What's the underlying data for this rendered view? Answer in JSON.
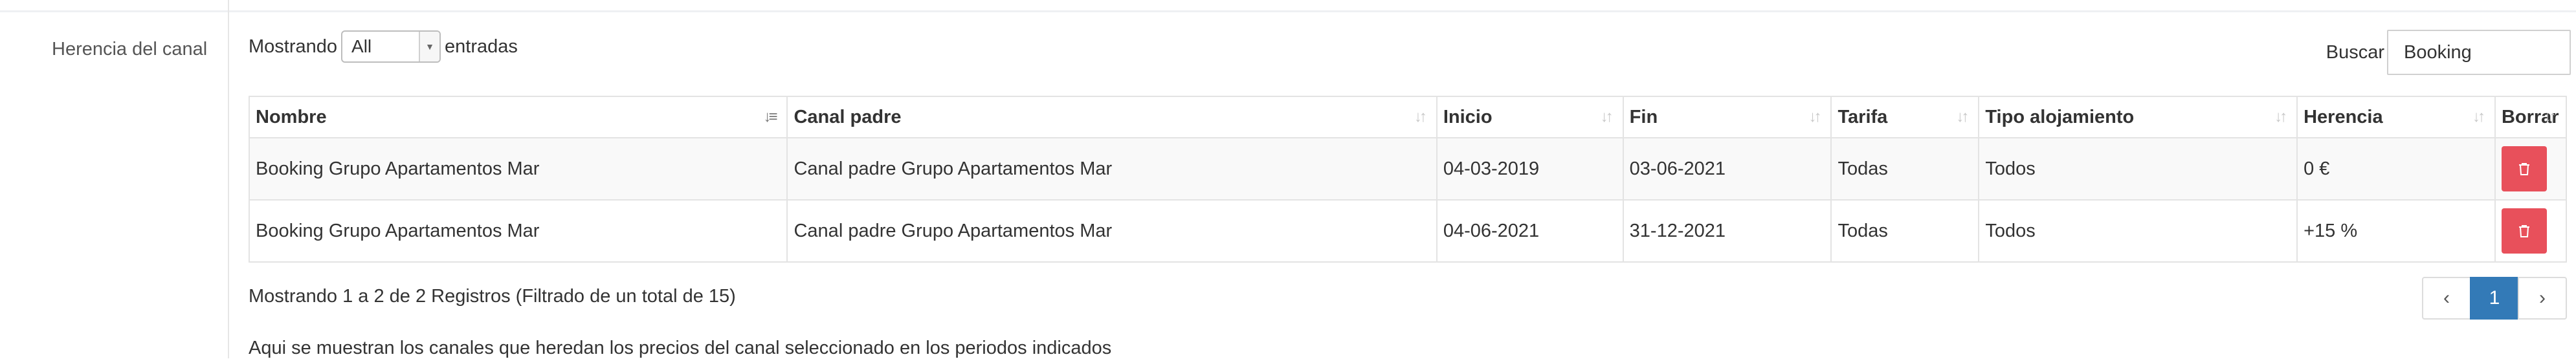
{
  "section": {
    "label": "Herencia del canal"
  },
  "length_control": {
    "prefix": "Mostrando",
    "selected": "All",
    "suffix": "entradas"
  },
  "search": {
    "label": "Buscar",
    "value": "Booking"
  },
  "table": {
    "headers": [
      "Nombre",
      "Canal padre",
      "Inicio",
      "Fin",
      "Tarifa",
      "Tipo alojamiento",
      "Herencia",
      "Borrar"
    ],
    "rows": [
      [
        "Booking Grupo Apartamentos Mar",
        "Canal padre Grupo Apartamentos Mar",
        "04-03-2019",
        "03-06-2021",
        "Todas",
        "Todos",
        "0 €"
      ],
      [
        "Booking Grupo Apartamentos Mar",
        "Canal padre Grupo Apartamentos Mar",
        "04-06-2021",
        "31-12-2021",
        "Todas",
        "Todos",
        "+15 %"
      ]
    ],
    "delete_icon": "trash-icon",
    "sort_icon": "sort-icon",
    "sorted_column": "Nombre"
  },
  "info": "Mostrando 1 a 2 de 2 Registros (Filtrado de un total de 15)",
  "pagination": {
    "prev": "‹",
    "current": "1",
    "next": "›"
  },
  "note": "Aqui se muestran los canales que heredan los precios del canal seleccionado en los periodos indicados",
  "colors": {
    "delete": "#e8505b",
    "page_active": "#337ab7"
  }
}
